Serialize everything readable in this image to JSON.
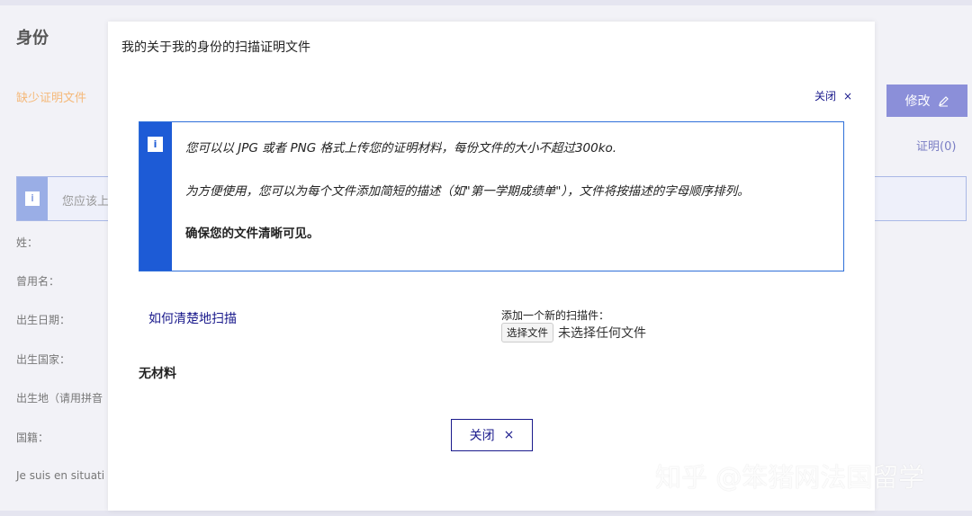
{
  "background": {
    "title": "身份",
    "missing_docs": "缺少证明文件",
    "edit_label": "修改",
    "certificate_count": "证明(0)",
    "notice_text": "您应该上",
    "fields": [
      "姓：",
      "曾用名：",
      "出生日期：",
      "出生国家：",
      "出生地（请用拼音",
      "国籍：",
      "Je suis en situati"
    ]
  },
  "modal": {
    "title": "我的关于我的身份的扫描证明文件",
    "close_top_label": "关闭",
    "info": {
      "line1": "您可以以 JPG 或者 PNG 格式上传您的证明材料，每份文件的大小不超过300ko.",
      "line2": "为方便使用，您可以为每个文件添加简短的描述（如\"第一学期成绩单\"），文件将按描述的字母顺序排列。",
      "line3": "确保您的文件清晰可见。"
    },
    "how_to_scan_link": "如何清楚地扫描",
    "upload_label": "添加一个新的扫描件：",
    "choose_file_label": "选择文件",
    "no_file_chosen": "未选择任何文件",
    "no_material": "无材料",
    "close_bottom_label": "关闭"
  },
  "watermark": "知乎 @笨猪网法国留学",
  "icons": {
    "info": "i",
    "close": "×",
    "edit": "pencil-icon"
  },
  "colors": {
    "primary": "#1d5bd6",
    "link": "#1a1a8c",
    "warning": "#f5b97a",
    "edit_button": "#8b8fd9"
  }
}
